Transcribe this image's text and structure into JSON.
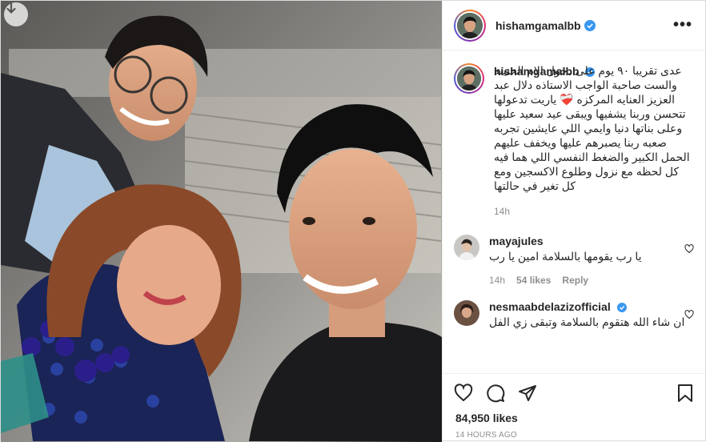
{
  "post": {
    "username": "hishamgamalbb",
    "more_label": "•••",
    "caption": {
      "username": "hishamgamalbb",
      "text": "عدى تقريبا ٩٠ يوم على دخول الام الحنينه والست صاحبة الواجب الاستاذه دلال عبد العزيز العنايه المركزه ❤️‍🩹\nياريت تدعولها تتحسن وربنا يشفيها ويبقى عيد سعيد عليها وعلى بناتها دنيا وايمي اللي عايشين تجربه صعبه ربنا يصبرهم عليها ويخفف عليهم الحمل الكبير والضغط النفسي اللي هما فيه كل لحظه مع نزول وطلوع الاكسجين ومع كل تغير في حالتها",
      "time": "14h"
    },
    "comments": [
      {
        "username": "mayajules",
        "verified": false,
        "text": "يا رب يقومها بالسلامة امين يا رب",
        "time": "14h",
        "likes": "54 likes",
        "reply": "Reply"
      },
      {
        "username": "nesmaabdelazizofficial",
        "verified": true,
        "text": "ان شاء الله هتقوم بالسلامة وتبقى زي الفل",
        "time": "",
        "likes": "",
        "reply": ""
      }
    ],
    "likes_count": "84,950 likes",
    "posted_ago": "14 HOURS AGO",
    "colors": {
      "verified": "#3897f0",
      "text": "#262626",
      "muted": "#8e8e8e",
      "border": "#efefef"
    },
    "icons": [
      "download-icon",
      "verified-icon",
      "heart-icon",
      "comment-icon",
      "share-icon",
      "bookmark-icon"
    ]
  }
}
